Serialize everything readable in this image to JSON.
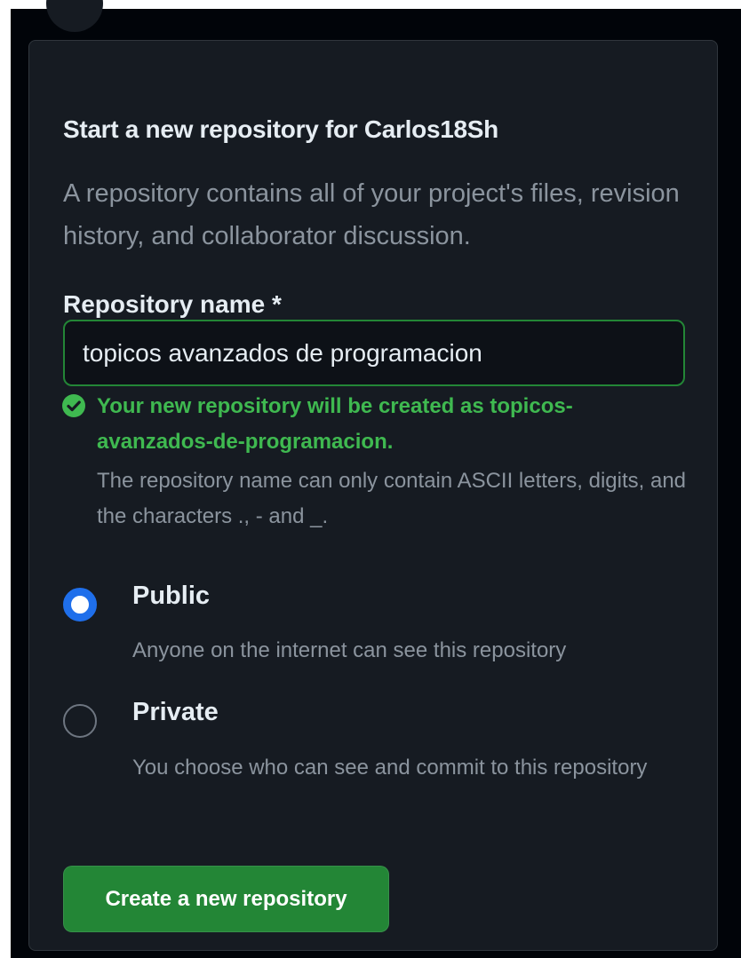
{
  "form": {
    "title": "Start a new repository for Carlos18Sh",
    "description": "A repository contains all of your project's files, revision history, and collaborator discussion.",
    "name_label": "Repository name *",
    "name_value": "topicos avanzados de programacion",
    "validation_message": "Your new repository will be created as topicos-avanzados-de-programacion.",
    "name_hint": "The repository name can only contain ASCII letters, digits, and the characters ., - and _.",
    "visibility": {
      "selected": "Public",
      "options": [
        {
          "label": "Public",
          "description": "Anyone on the internet can see this repository"
        },
        {
          "label": "Private",
          "description": "You choose who can see and commit to this repository"
        }
      ]
    },
    "create_button": "Create a new repository"
  },
  "colors": {
    "background": "#010409",
    "card": "#161b22",
    "accent_green": "#238636",
    "success_text": "#3fb950",
    "radio_blue": "#1f6feb"
  },
  "icons": {
    "validation": "check-circle-fill-icon"
  }
}
